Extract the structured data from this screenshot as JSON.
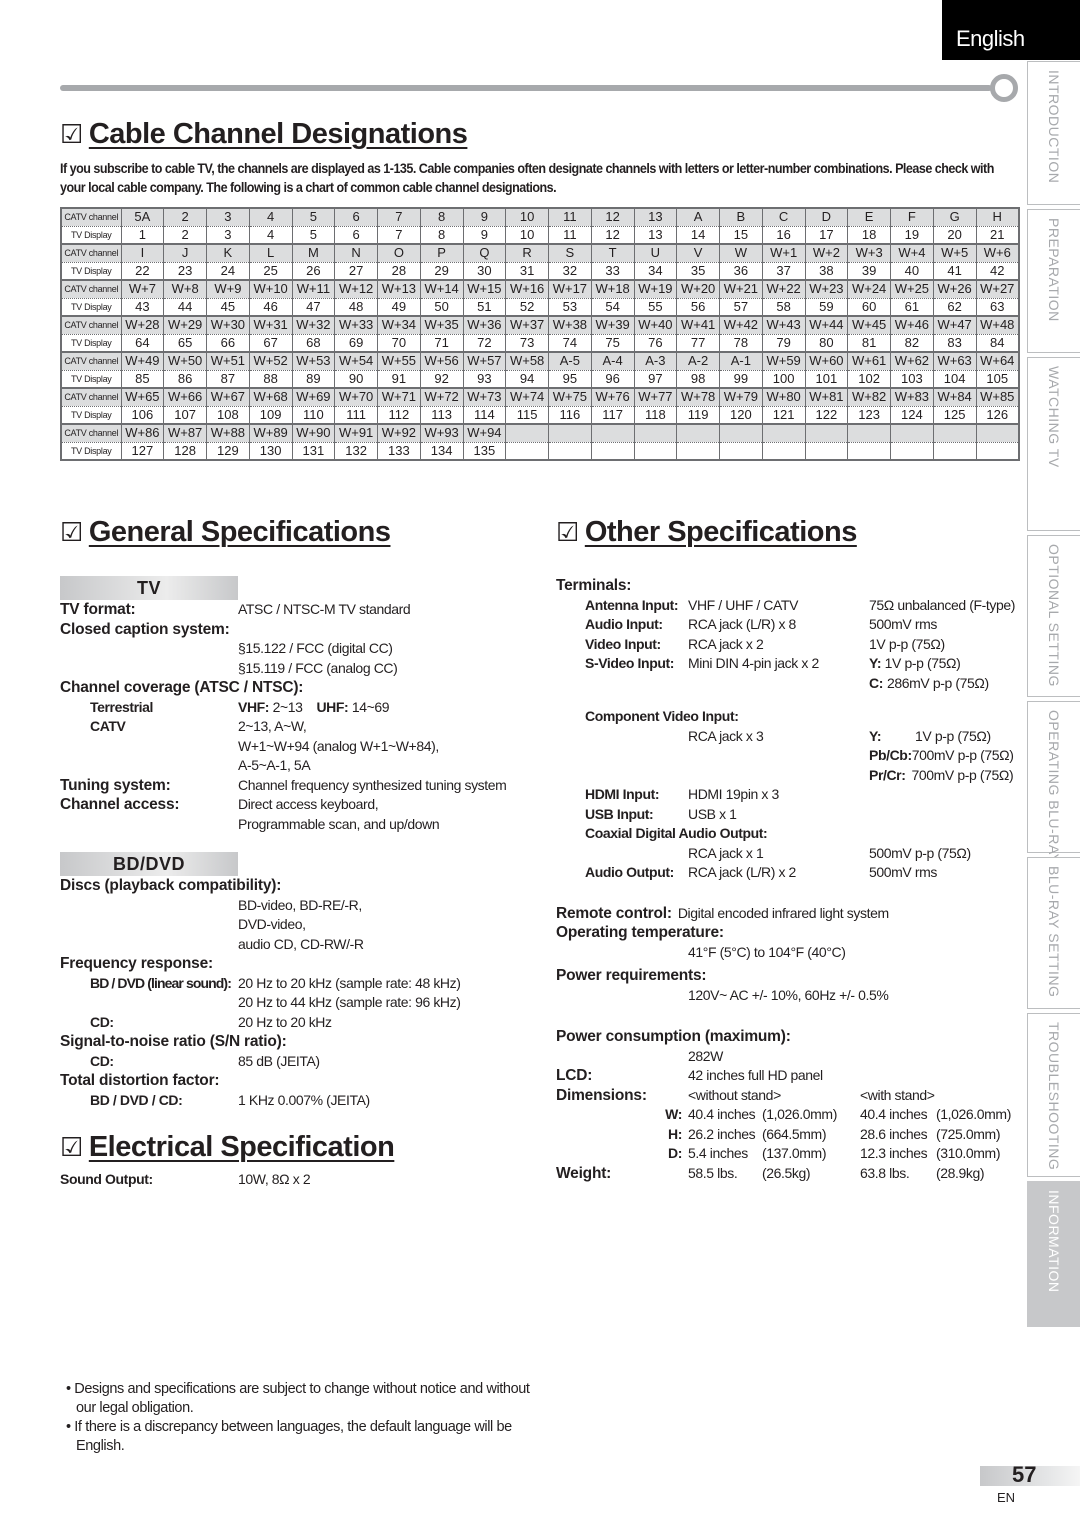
{
  "language_tab": "English",
  "side_tabs": [
    {
      "label": "INTRODUCTION",
      "active": false
    },
    {
      "label": "PREPARATION",
      "active": false
    },
    {
      "label": "WATCHING  TV",
      "active": false
    },
    {
      "label": "OPTIONAL  SETTING",
      "active": false
    },
    {
      "label": "OPERATING  BLU-RAY",
      "active": false
    },
    {
      "label": "BLU-RAY  SETTING",
      "active": false
    },
    {
      "label": "TROUBLESHOOTING",
      "active": false
    },
    {
      "label": "INFORMATION",
      "active": true
    }
  ],
  "checkbox_icon": "☑",
  "cable": {
    "title": "Cable Channel Designations",
    "intro": "If you subscribe to cable TV, the channels are displayed as 1-135. Cable companies often designate channels with letters or letter-number combinations. Please check with your local cable company. The following is a chart of common cable channel designations.",
    "row_labels": {
      "catv": "CATV channel",
      "display": "TV Display"
    },
    "blocks": [
      {
        "catv": [
          "5A",
          "2",
          "3",
          "4",
          "5",
          "6",
          "7",
          "8",
          "9",
          "10",
          "11",
          "12",
          "13",
          "A",
          "B",
          "C",
          "D",
          "E",
          "F",
          "G",
          "H"
        ],
        "display": [
          "1",
          "2",
          "3",
          "4",
          "5",
          "6",
          "7",
          "8",
          "9",
          "10",
          "11",
          "12",
          "13",
          "14",
          "15",
          "16",
          "17",
          "18",
          "19",
          "20",
          "21"
        ]
      },
      {
        "catv": [
          "I",
          "J",
          "K",
          "L",
          "M",
          "N",
          "O",
          "P",
          "Q",
          "R",
          "S",
          "T",
          "U",
          "V",
          "W",
          "W+1",
          "W+2",
          "W+3",
          "W+4",
          "W+5",
          "W+6"
        ],
        "display": [
          "22",
          "23",
          "24",
          "25",
          "26",
          "27",
          "28",
          "29",
          "30",
          "31",
          "32",
          "33",
          "34",
          "35",
          "36",
          "37",
          "38",
          "39",
          "40",
          "41",
          "42"
        ]
      },
      {
        "catv": [
          "W+7",
          "W+8",
          "W+9",
          "W+10",
          "W+11",
          "W+12",
          "W+13",
          "W+14",
          "W+15",
          "W+16",
          "W+17",
          "W+18",
          "W+19",
          "W+20",
          "W+21",
          "W+22",
          "W+23",
          "W+24",
          "W+25",
          "W+26",
          "W+27"
        ],
        "display": [
          "43",
          "44",
          "45",
          "46",
          "47",
          "48",
          "49",
          "50",
          "51",
          "52",
          "53",
          "54",
          "55",
          "56",
          "57",
          "58",
          "59",
          "60",
          "61",
          "62",
          "63"
        ]
      },
      {
        "catv": [
          "W+28",
          "W+29",
          "W+30",
          "W+31",
          "W+32",
          "W+33",
          "W+34",
          "W+35",
          "W+36",
          "W+37",
          "W+38",
          "W+39",
          "W+40",
          "W+41",
          "W+42",
          "W+43",
          "W+44",
          "W+45",
          "W+46",
          "W+47",
          "W+48"
        ],
        "display": [
          "64",
          "65",
          "66",
          "67",
          "68",
          "69",
          "70",
          "71",
          "72",
          "73",
          "74",
          "75",
          "76",
          "77",
          "78",
          "79",
          "80",
          "81",
          "82",
          "83",
          "84"
        ]
      },
      {
        "catv": [
          "W+49",
          "W+50",
          "W+51",
          "W+52",
          "W+53",
          "W+54",
          "W+55",
          "W+56",
          "W+57",
          "W+58",
          "A-5",
          "A-4",
          "A-3",
          "A-2",
          "A-1",
          "W+59",
          "W+60",
          "W+61",
          "W+62",
          "W+63",
          "W+64"
        ],
        "display": [
          "85",
          "86",
          "87",
          "88",
          "89",
          "90",
          "91",
          "92",
          "93",
          "94",
          "95",
          "96",
          "97",
          "98",
          "99",
          "100",
          "101",
          "102",
          "103",
          "104",
          "105"
        ]
      },
      {
        "catv": [
          "W+65",
          "W+66",
          "W+67",
          "W+68",
          "W+69",
          "W+70",
          "W+71",
          "W+72",
          "W+73",
          "W+74",
          "W+75",
          "W+76",
          "W+77",
          "W+78",
          "W+79",
          "W+80",
          "W+81",
          "W+82",
          "W+83",
          "W+84",
          "W+85"
        ],
        "display": [
          "106",
          "107",
          "108",
          "109",
          "110",
          "111",
          "112",
          "113",
          "114",
          "115",
          "116",
          "117",
          "118",
          "119",
          "120",
          "121",
          "122",
          "123",
          "124",
          "125",
          "126"
        ]
      },
      {
        "catv": [
          "W+86",
          "W+87",
          "W+88",
          "W+89",
          "W+90",
          "W+91",
          "W+92",
          "W+93",
          "W+94",
          "",
          "",
          "",
          "",
          "",
          "",
          "",
          "",
          "",
          "",
          "",
          ""
        ],
        "display": [
          "127",
          "128",
          "129",
          "130",
          "131",
          "132",
          "133",
          "134",
          "135",
          "",
          "",
          "",
          "",
          "",
          "",
          "",
          "",
          "",
          "",
          "",
          ""
        ]
      }
    ]
  },
  "general": {
    "title": "General Specifications",
    "tv_band": "TV",
    "tv_format_k": "TV format:",
    "tv_format_v": "ATSC / NTSC-M TV standard",
    "cc_k": "Closed caption system:",
    "cc_v1": "§15.122 / FCC (digital CC)",
    "cc_v2": "§15.119 / FCC (analog CC)",
    "coverage_k": "Channel coverage (ATSC / NTSC):",
    "terrestrial_k": "Terrestrial",
    "vhf_k": "VHF:",
    "vhf_v": "2~13",
    "uhf_k": "UHF:",
    "uhf_v": "14~69",
    "catv_k": "CATV",
    "catv_v1": "2~13, A~W,",
    "catv_v2": "W+1~W+94 (analog W+1~W+84),",
    "catv_v3": "A-5~A-1, 5A",
    "tuning_k": "Tuning system:",
    "tuning_v": "Channel frequency synthesized tuning system",
    "access_k": "Channel access:",
    "access_v1": "Direct access keyboard,",
    "access_v2": "Programmable scan, and up/down",
    "bd_band": "BD/DVD",
    "discs_k": "Discs (playback compatibility):",
    "discs_v1": "BD-video, BD-RE/-R,",
    "discs_v2": "DVD-video,",
    "discs_v3": "audio CD, CD-RW/-R",
    "freq_k": "Frequency response:",
    "freq_bd_k": "BD / DVD (linear sound):",
    "freq_bd_v1": "20 Hz to 20 kHz (sample rate: 48 kHz)",
    "freq_bd_v2": "20 Hz to 44 kHz (sample rate: 96 kHz)",
    "freq_cd_k": "CD:",
    "freq_cd_v": "20 Hz to 20 kHz",
    "snr_k": "Signal-to-noise ratio (S/N ratio):",
    "snr_cd_k": "CD:",
    "snr_cd_v": "85 dB (JEITA)",
    "thd_k": "Total distortion factor:",
    "thd_sub_k": "BD / DVD / CD:",
    "thd_v": "1 KHz 0.007% (JEITA)"
  },
  "electrical": {
    "title": "Electrical Specification",
    "sound_k": "Sound Output:",
    "sound_v": "10W, 8Ω x 2"
  },
  "other": {
    "title": "Other Specifications",
    "terminals_k": "Terminals:",
    "terminals": [
      {
        "k": "Antenna Input:",
        "v": "VHF / UHF / CATV",
        "r": "75Ω unbalanced (F-type)"
      },
      {
        "k": "Audio Input:",
        "v": "RCA jack (L/R) x 8",
        "r": "500mV rms"
      },
      {
        "k": "Video Input:",
        "v": "RCA jack x 2",
        "r": "1V p-p (75Ω)"
      },
      {
        "k": "S-Video Input:",
        "v": "Mini DIN 4-pin jack x 2",
        "rk": "Y:",
        "r": "1V p-p (75Ω)",
        "rk2": "C:",
        "r2": "286mV p-p (75Ω)"
      }
    ],
    "component_k": "Component Video Input:",
    "component_v": "RCA jack x 3",
    "component_r": [
      {
        "k": "Y:",
        "v": "1V p-p (75Ω)"
      },
      {
        "k": "Pb/Cb:",
        "v": "700mV p-p (75Ω)"
      },
      {
        "k": "Pr/Cr:",
        "v": "700mV p-p (75Ω)"
      }
    ],
    "hdmi_k": "HDMI Input:",
    "hdmi_v": "HDMI 19pin x 3",
    "usb_k": "USB Input:",
    "usb_v": "USB x 1",
    "coax_k": "Coaxial Digital Audio Output:",
    "coax_v": "RCA jack x 1",
    "coax_r": "500mV p-p (75Ω)",
    "aout_k": "Audio Output:",
    "aout_v": "RCA jack (L/R) x 2",
    "aout_r": "500mV rms",
    "remote_k": "Remote control:",
    "remote_v": "Digital encoded infrared light system",
    "optemp_k": "Operating temperature:",
    "optemp_v": "41°F (5°C) to 104°F (40°C)",
    "power_k": "Power requirements:",
    "power_v": "120V~ AC +/- 10%, 60Hz +/- 0.5%",
    "consump_k": "Power consumption (maximum):",
    "consump_v": "282W",
    "lcd_k": "LCD:",
    "lcd_v": "42 inches full HD panel",
    "dim_k": "Dimensions:",
    "dim_without": "<without stand>",
    "dim_with": "<with stand>",
    "dims": [
      {
        "k": "W:",
        "a": "40.4 inches",
        "b": "(1,026.0mm)",
        "c": "40.4 inches",
        "d": "(1,026.0mm)"
      },
      {
        "k": "H:",
        "a": "26.2 inches",
        "b": "(664.5mm)",
        "c": "28.6 inches",
        "d": "(725.0mm)"
      },
      {
        "k": "D:",
        "a": "5.4 inches",
        "b": "(137.0mm)",
        "c": "12.3 inches",
        "d": "(310.0mm)"
      }
    ],
    "weight_k": "Weight:",
    "weight": {
      "a": "58.5 lbs.",
      "b": "(26.5kg)",
      "c": "63.8 lbs.",
      "d": "(28.9kg)"
    }
  },
  "notes": [
    "• Designs and specifications are subject to change without notice and without our legal obligation.",
    "• If there is a discrepancy between languages, the default language will be English."
  ],
  "page": {
    "number": "57",
    "lang": "EN"
  }
}
